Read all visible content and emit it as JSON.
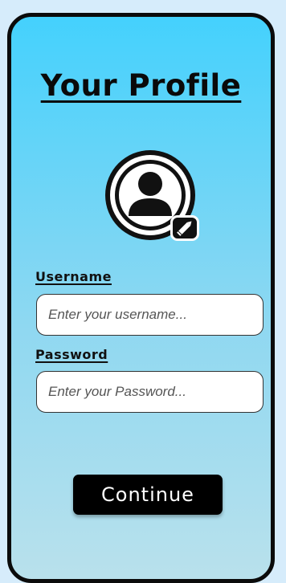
{
  "profile": {
    "title": "Your Profile"
  },
  "avatar": {
    "icon": "user-icon",
    "edit_icon": "pencil-icon"
  },
  "form": {
    "username_label": "Username",
    "username_placeholder": "Enter your username...",
    "username_value": "",
    "password_label": "Password",
    "password_placeholder": "Enter your Password...",
    "password_value": ""
  },
  "actions": {
    "continue_label": "Continue"
  },
  "colors": {
    "page_background": "#d6ecfb",
    "gradient_top": "#44d1fd",
    "gradient_bottom": "#b9e1ec",
    "button": "#000000",
    "text": "#111111"
  }
}
